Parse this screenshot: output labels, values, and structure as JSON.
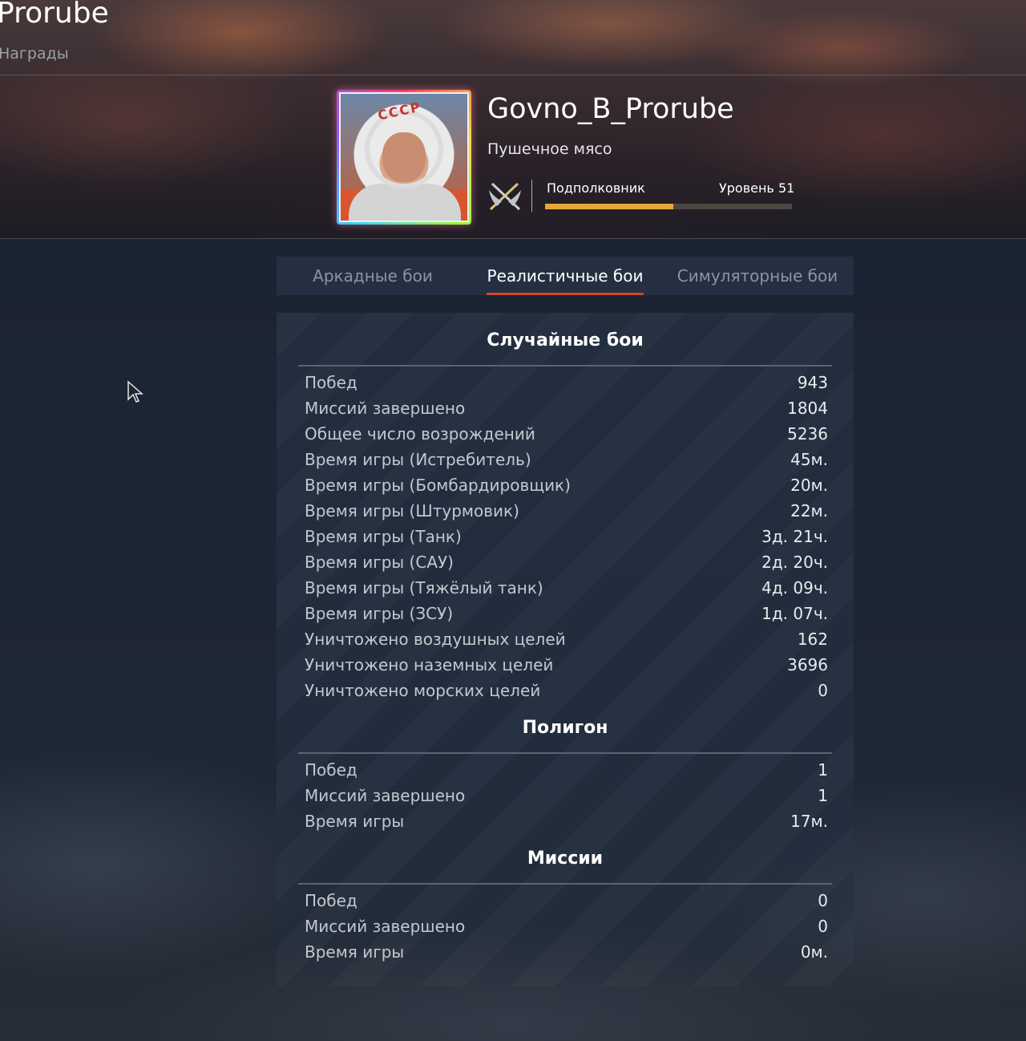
{
  "header": {
    "title": "Prorube",
    "subtitle": "Награды"
  },
  "player": {
    "name": "Govno_B_Prorube",
    "title": "Пушечное мясо",
    "rank_icon": "crossed-wings-icon",
    "rank": "Подполковник",
    "level_label": "Уровень",
    "level": "51",
    "progress_fraction": 0.52,
    "progress_color": "#e6a73a"
  },
  "tabs": [
    {
      "label": "Аркадные бои",
      "active": false
    },
    {
      "label": "Реалистичные бои",
      "active": true
    },
    {
      "label": "Симуляторные бои",
      "active": false
    }
  ],
  "sections": {
    "random": {
      "title": "Случайные бои",
      "rows": [
        {
          "label": "Побед",
          "value": "943"
        },
        {
          "label": "Миссий завершено",
          "value": "1804"
        },
        {
          "label": "Общее число возрождений",
          "value": "5236"
        },
        {
          "label": "Время игры (Истребитель)",
          "value": "45м."
        },
        {
          "label": "Время игры (Бомбардировщик)",
          "value": "20м."
        },
        {
          "label": "Время игры (Штурмовик)",
          "value": "22м."
        },
        {
          "label": "Время игры (Танк)",
          "value": "3д. 21ч."
        },
        {
          "label": "Время игры (САУ)",
          "value": "2д. 20ч."
        },
        {
          "label": "Время игры (Тяжёлый танк)",
          "value": "4д. 09ч."
        },
        {
          "label": "Время игры (ЗСУ)",
          "value": "1д. 07ч."
        },
        {
          "label": "Уничтожено воздушных целей",
          "value": "162"
        },
        {
          "label": "Уничтожено наземных целей",
          "value": "3696"
        },
        {
          "label": "Уничтожено морских целей",
          "value": "0"
        }
      ]
    },
    "polygon": {
      "title": "Полигон",
      "rows": [
        {
          "label": "Побед",
          "value": "1"
        },
        {
          "label": "Миссий завершено",
          "value": "1"
        },
        {
          "label": "Время игры",
          "value": "17м."
        }
      ]
    },
    "missions": {
      "title": "Миссии",
      "rows": [
        {
          "label": "Побед",
          "value": "0"
        },
        {
          "label": "Миссий завершено",
          "value": "0"
        },
        {
          "label": "Время игры",
          "value": "0м."
        }
      ]
    }
  },
  "colors": {
    "accent_tab_underline": "#d2452c"
  }
}
